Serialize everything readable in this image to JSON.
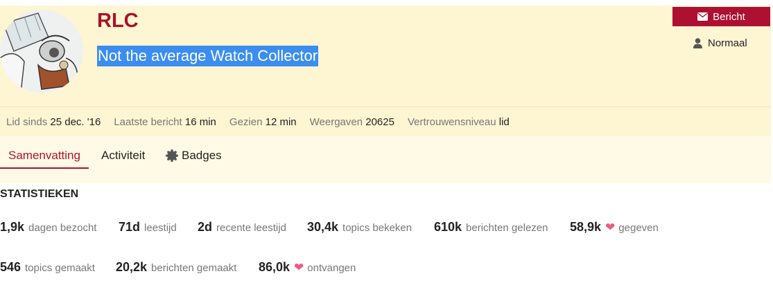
{
  "profile": {
    "username": "RLC",
    "title": "Not the average Watch Collector",
    "message_button": "Bericht",
    "trust_label": "Normaal"
  },
  "info": [
    {
      "label": "Lid sinds",
      "value": "25 dec. '16"
    },
    {
      "label": "Laatste bericht",
      "value": "16 min"
    },
    {
      "label": "Gezien",
      "value": "12 min"
    },
    {
      "label": "Weergaven",
      "value": "20625"
    },
    {
      "label": "Vertrouwensniveau",
      "value": "lid"
    }
  ],
  "tabs": [
    "Samenvatting",
    "Activiteit",
    "Badges"
  ],
  "stats": {
    "heading": "STATISTIEKEN",
    "items": [
      {
        "value": "1,9k",
        "label": "dagen bezocht"
      },
      {
        "value": "71d",
        "label": "leestijd"
      },
      {
        "value": "2d",
        "label": "recente leestijd"
      },
      {
        "value": "30,4k",
        "label": "topics bekeken"
      },
      {
        "value": "610k",
        "label": "berichten gelezen"
      },
      {
        "value": "58,9k",
        "label": "gegeven",
        "icon": "heart-icon"
      },
      {
        "value": "546",
        "label": "topics gemaakt"
      },
      {
        "value": "20,2k",
        "label": "berichten gemaakt"
      },
      {
        "value": "86,0k",
        "label": "ontvangen",
        "icon": "heart-icon"
      }
    ]
  },
  "colors": {
    "accent": "#ad1030",
    "header_bg": "#fef5d3",
    "heart": "#f05a7e",
    "selection": "#3b8df0"
  }
}
